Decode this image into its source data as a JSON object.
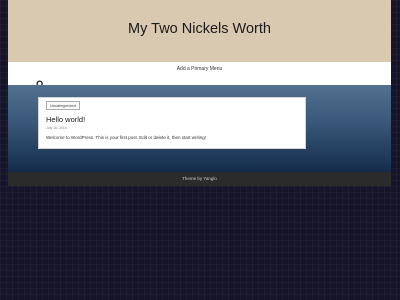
{
  "header": {
    "site_title": "My Two Nickels Worth",
    "background_color": "#d8c9b0"
  },
  "nav": {
    "primary_menu_label": "Add a Primary Menu",
    "search_icon": "search-icon"
  },
  "post": {
    "category": "Uncategorized",
    "title": "Hello world!",
    "date": "July 16, 2016",
    "excerpt": "Welcome to WordPress. This is your first post. Edit or delete it, then start writing!"
  },
  "footer": {
    "credit": "Theme by Yanglo"
  },
  "colors": {
    "page_background": "#161428",
    "content_gradient_top": "#52708f",
    "content_gradient_bottom": "#142c4a",
    "footer_background": "#2b2b2b"
  }
}
